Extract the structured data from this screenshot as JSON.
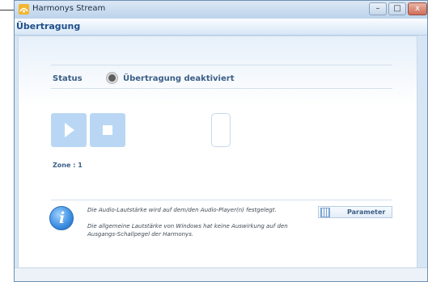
{
  "window": {
    "title": "Harmonys Stream",
    "min_symbol": "–",
    "max_symbol": "□",
    "close_symbol": "x"
  },
  "header": {
    "title": "Übertragung"
  },
  "status": {
    "label": "Status",
    "value": "Übertragung deaktiviert"
  },
  "zone": {
    "label": "Zone : 1"
  },
  "info": {
    "line1": "Die Audio-Lautstärke wird auf dem/den Audio-Player(n) festgelegt.",
    "line2": "Die allgemeine Lautstärke von Windows hat keine Auswirkung auf den Ausgangs-Schallpegel der Harmonys."
  },
  "buttons": {
    "parameter": "Parameter"
  },
  "icons": {
    "app": "harmonys-app-icon",
    "info": "info-icon",
    "play": "play-icon",
    "stop": "stop-icon",
    "parameter": "equalizer-icon"
  },
  "colors": {
    "accent": "#1f4f8a",
    "tile": "#b9d7f4",
    "label": "#3b5e86"
  }
}
